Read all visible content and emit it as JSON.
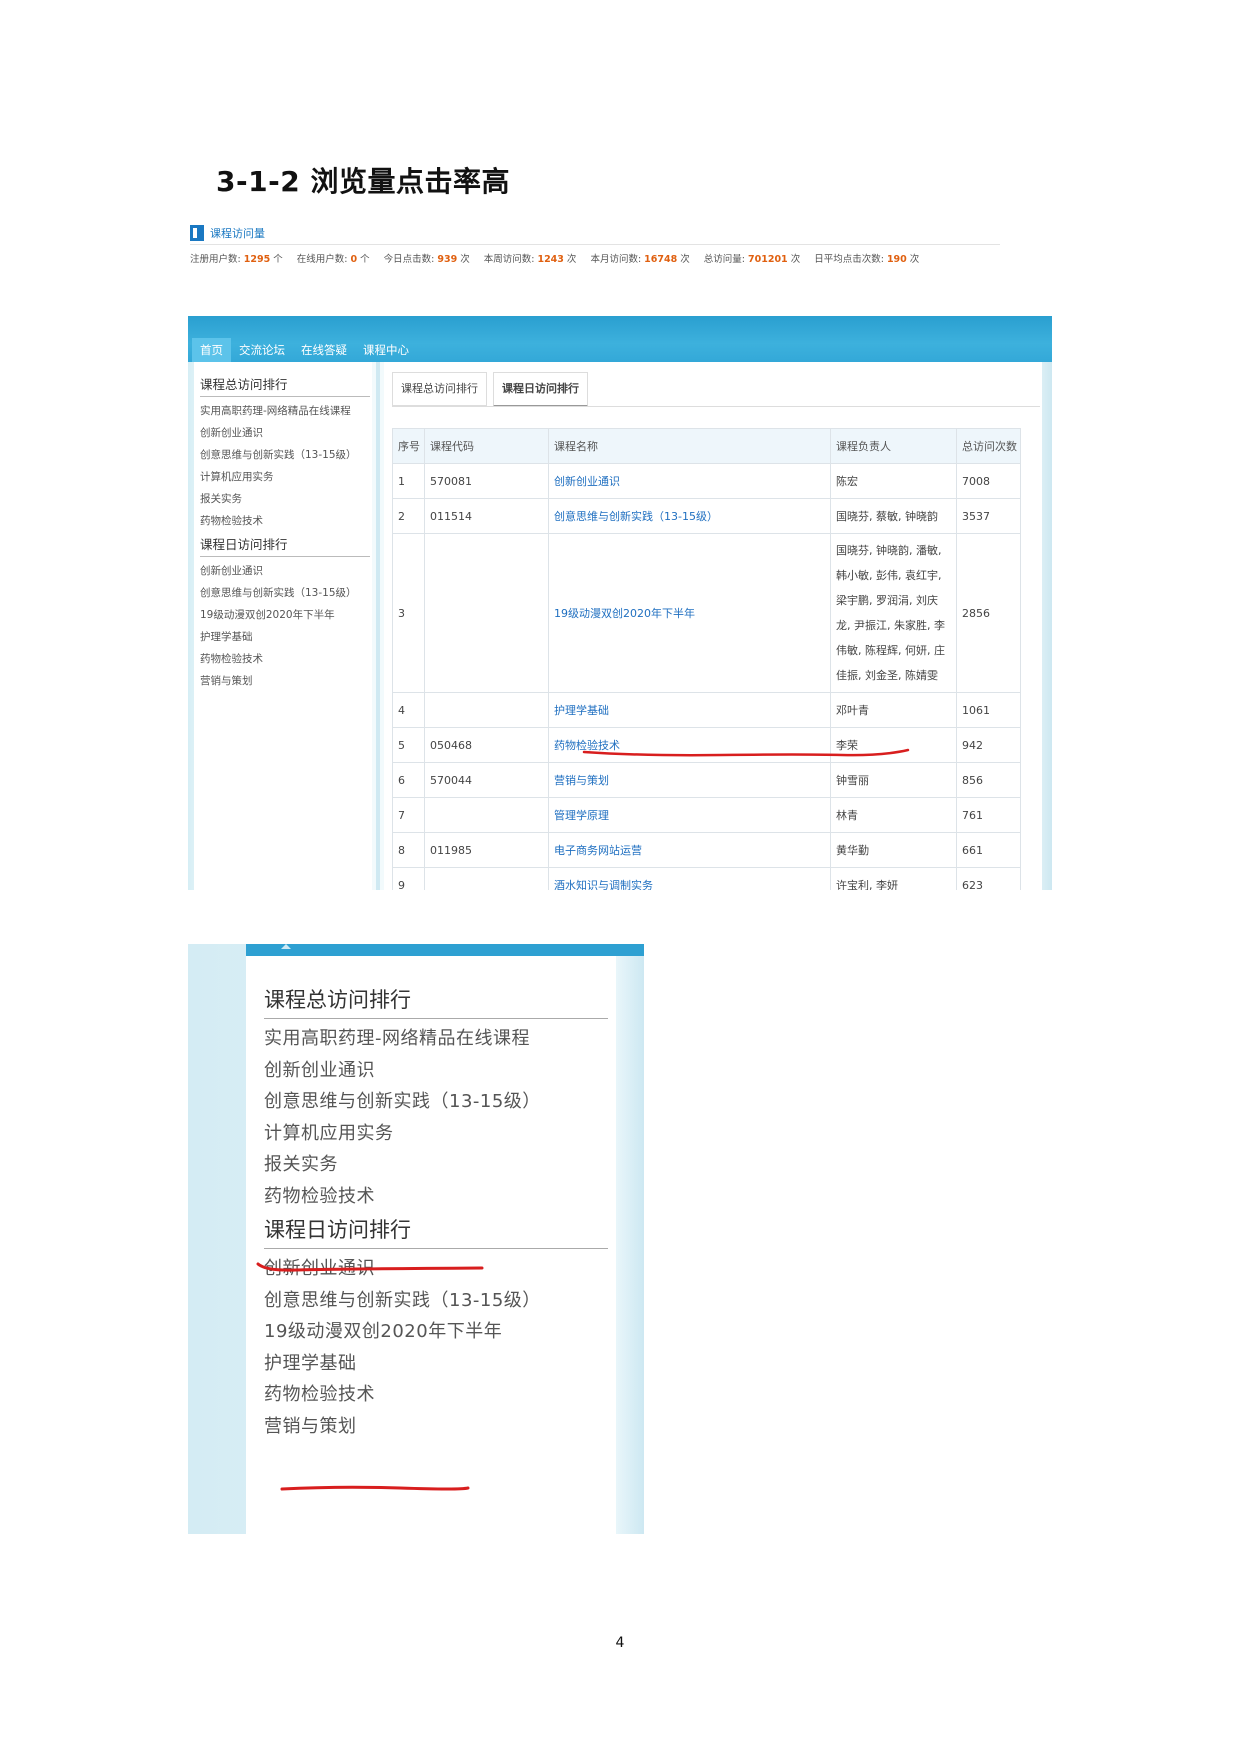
{
  "heading": "3-1-2 浏览量点击率高",
  "stats": {
    "title": "课程访问量",
    "items": [
      {
        "label": "注册用户数:",
        "value": "1295",
        "unit": "个"
      },
      {
        "label": "在线用户数:",
        "value": "0",
        "unit": "个"
      },
      {
        "label": "今日点击数:",
        "value": "939",
        "unit": "次"
      },
      {
        "label": "本周访问数:",
        "value": "1243",
        "unit": "次"
      },
      {
        "label": "本月访问数:",
        "value": "16748",
        "unit": "次"
      },
      {
        "label": "总访问量:",
        "value": "701201",
        "unit": "次"
      },
      {
        "label": "日平均点击次数:",
        "value": "190",
        "unit": "次"
      }
    ]
  },
  "nav": [
    "首页",
    "交流论坛",
    "在线答疑",
    "课程中心"
  ],
  "sidebar": {
    "total_title": "课程总访问排行",
    "total_items": [
      "实用高职药理-网络精品在线课程",
      "创新创业通识",
      "创意思维与创新实践（13-15级）",
      "计算机应用实务",
      "报关实务",
      "药物检验技术"
    ],
    "daily_title": "课程日访问排行",
    "daily_items": [
      "创新创业通识",
      "创意思维与创新实践（13-15级）",
      "19级动漫双创2020年下半年",
      "护理学基础",
      "药物检验技术",
      "营销与策划"
    ]
  },
  "tabs": [
    "课程总访问排行",
    "课程日访问排行"
  ],
  "table": {
    "headers": [
      "序号",
      "课程代码",
      "课程名称",
      "课程负责人",
      "总访问次数"
    ],
    "rows": [
      [
        "1",
        "570081",
        "创新创业通识",
        "陈宏",
        "7008"
      ],
      [
        "2",
        "011514",
        "创意思维与创新实践（13-15级）",
        "国晓芬, 蔡敏, 钟晓韵",
        "3537"
      ],
      [
        "3",
        "",
        "19级动漫双创2020年下半年",
        "国晓芬, 钟晓韵, 潘敏, 韩小敏, 彭伟, 袁红宇, 梁宇鹏, 罗润涓, 刘庆龙, 尹振江, 朱家胜, 李伟敏, 陈程辉, 何妍, 庄佳振, 刘金圣, 陈婧雯",
        "2856"
      ],
      [
        "4",
        "",
        "护理学基础",
        "邓叶青",
        "1061"
      ],
      [
        "5",
        "050468",
        "药物检验技术",
        "李荣",
        "942"
      ],
      [
        "6",
        "570044",
        "营销与策划",
        "钟雪丽",
        "856"
      ],
      [
        "7",
        "",
        "管理学原理",
        "林青",
        "761"
      ],
      [
        "8",
        "011985",
        "电子商务网站运营",
        "黄华勤",
        "661"
      ],
      [
        "9",
        "",
        "酒水知识与调制实务",
        "许宝利, 李妍",
        "623"
      ]
    ]
  },
  "page_number": "4",
  "colors": {
    "nav_blue": "#33a8d8",
    "link": "#1f6fc0",
    "stat_number": "#e06010",
    "underline_red": "#d81e1e"
  }
}
